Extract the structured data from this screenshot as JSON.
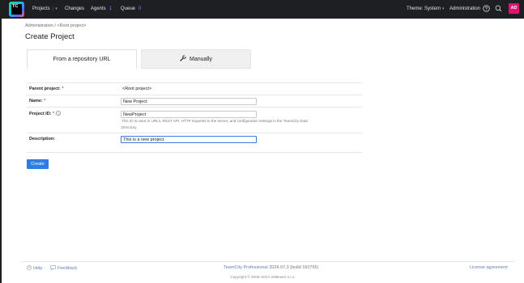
{
  "app": {
    "logo_text": "TC"
  },
  "topbar": {
    "nav": [
      {
        "label": "Projects",
        "caret": "▾",
        "sep": "|"
      },
      {
        "label": "Changes"
      },
      {
        "label": "Agents",
        "count": "1"
      },
      {
        "label": "Queue",
        "count": "0"
      }
    ],
    "theme_label": "Theme: System",
    "theme_caret": "▾",
    "admin_label": "Administration",
    "avatar_initials": "AD",
    "icons": [
      "help-icon",
      "search-icon",
      "notifications-icon"
    ]
  },
  "breadcrumb": "Administration / <Root project>",
  "page_title": "Create Project",
  "tabs": [
    {
      "label": "From a repository URL",
      "selected": true
    },
    {
      "label": "Manually",
      "icon": "wrench-icon",
      "selected": false
    }
  ],
  "form": {
    "parent_label": "Parent project:",
    "parent_required": "*",
    "parent_value": "<Root project>",
    "name_label": "Name:",
    "name_required": "*",
    "name_value": "New Project",
    "id_label": "Project ID:",
    "id_required": "*",
    "id_help_glyph": "?",
    "id_value": "NewProject",
    "id_hint": "This ID is used in URLs, REST API, HTTP requests to the server, and configuration settings in the TeamCity Data Directory.",
    "description_label": "Description:",
    "description_value": "This is a new project."
  },
  "create_button": "Create",
  "footer": {
    "help": "Help",
    "feedback": "Feedback",
    "product": "TeamCity Professional",
    "version": "2024.07.3 (build 160765)",
    "license": "License agreement",
    "copyright": "Copyright © 2006–2024 JetBrains s.r.o."
  },
  "colors": {
    "accent": "#2d7de8",
    "topbar": "#1e1f22",
    "avatar": "#e0126f",
    "link": "#5f80b8"
  }
}
